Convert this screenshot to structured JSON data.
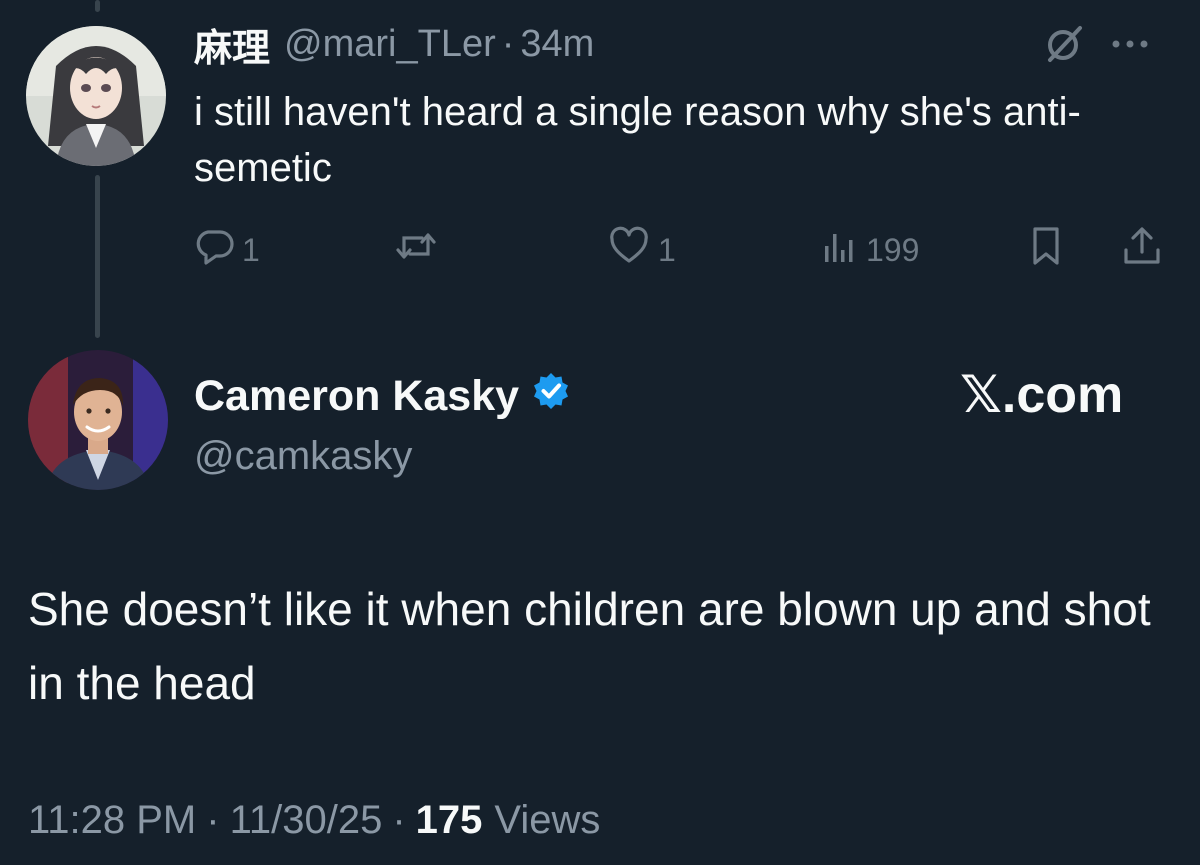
{
  "parent_tweet": {
    "display_name": "麻理",
    "handle": "@mari_TLer",
    "separator": "·",
    "time": "34m",
    "text": "i still haven't heard a single reason why she's anti-semetic",
    "avatar_icon": "anime-girl-avatar",
    "top_icons": [
      "grok-icon",
      "more-icon"
    ],
    "actions": {
      "replies": "1",
      "reposts": "",
      "likes": "1",
      "views": "199"
    }
  },
  "main_tweet": {
    "display_name": "Cameron Kasky",
    "verified": true,
    "handle": "@camkasky",
    "brand_mark": "𝕏",
    "brand_suffix": ".com",
    "text": "She doesn’t like it when children are blown up and shot in the head",
    "avatar_icon": "man-avatar",
    "meta": {
      "time": "11:28 PM",
      "separator": "·",
      "date": "11/30/25",
      "views_count": "175",
      "views_label": "Views"
    }
  },
  "colors": {
    "background": "#15202b",
    "text": "#f7f9f9",
    "muted": "#8b98a5",
    "icon": "#6e7a85",
    "verified": "#1d9bf0",
    "thread_line": "#38444d"
  }
}
